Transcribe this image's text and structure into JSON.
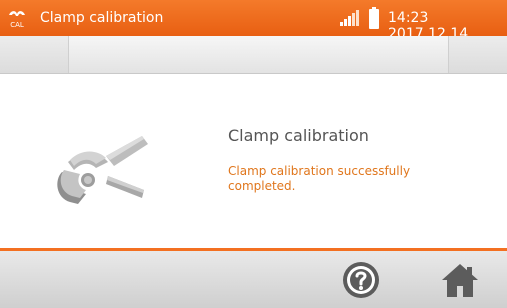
{
  "status_bar": {
    "title": "Clamp calibration",
    "logo_text_top": "",
    "logo_text_bottom": "CAL",
    "datetime": "14:23 2017.12.14",
    "icons": [
      "cal-logo-icon",
      "signal-icon",
      "battery-icon"
    ]
  },
  "main": {
    "heading": "Clamp calibration",
    "message": "Clamp calibration successfully completed.",
    "illustration": "clamp-icon"
  },
  "bottom_bar": {
    "buttons": [
      "help-icon",
      "home-icon"
    ]
  },
  "colors": {
    "accent": "#f37021",
    "message_text": "#e0761c",
    "heading_text": "#555555"
  }
}
